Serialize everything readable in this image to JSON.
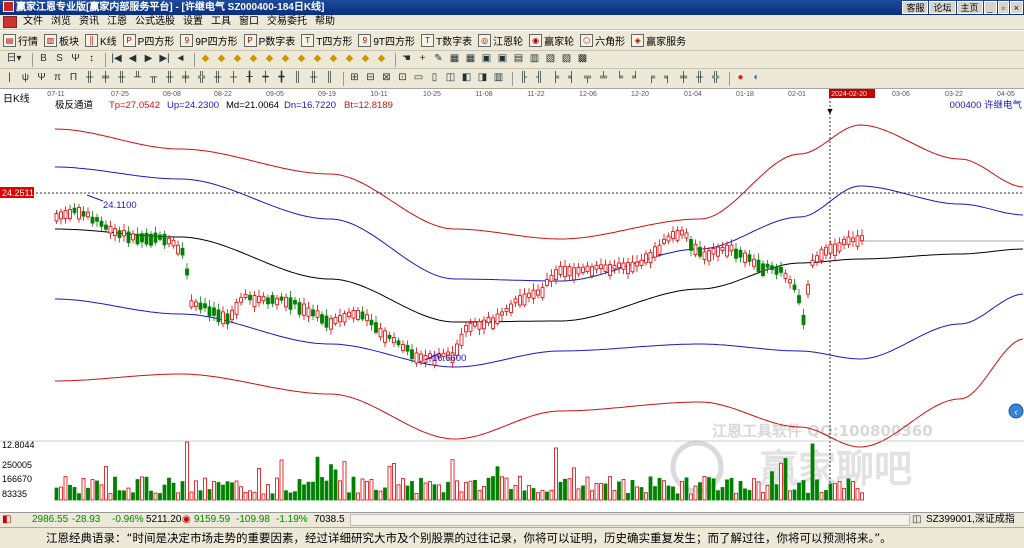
{
  "window": {
    "title": "赢家江恩专业版[赢家内部服务平台] - [许继电气   SZ000400-184日K线]",
    "right_buttons": [
      "客服",
      "论坛",
      "主页"
    ]
  },
  "menu": [
    "文件",
    "浏览",
    "资讯",
    "江恩",
    "公式选股",
    "设置",
    "工具",
    "窗口",
    "交易委托",
    "帮助"
  ],
  "toolbar1": [
    "行情",
    "板块",
    "K线",
    "P四方形",
    "9P四方形",
    "P数字表",
    "T四方形",
    "9T四方形",
    "T数字表",
    "江恩轮",
    "赢家轮",
    "六角形",
    "赢家服务"
  ],
  "toolbar2_icons": [
    "day-select",
    "buy-mark",
    "sell-mark",
    "forecast",
    "arrow-tool"
  ],
  "chart": {
    "period_label": "日K线",
    "indicator": {
      "name": "极反通道",
      "Tp": "Tp=27.0542",
      "Up": "Up=24.2300",
      "Md": "Md=21.0064",
      "Dn": "Dn=16.7220",
      "Bt": "Bt=12.8189"
    },
    "stock_label": "000400 许继电气",
    "price_tag": "24.2511",
    "high_label": "24.1100",
    "low_label": "16.6600",
    "date_ticks": [
      "07-11",
      "07-25",
      "08-08",
      "08-22",
      "09-05",
      "09-19",
      "10-11",
      "10-25",
      "11-08",
      "11-22",
      "12-06",
      "12-20",
      "01-04",
      "01-18",
      "02-01",
      "2024-02-20",
      "03-06",
      "03-22",
      "04-05"
    ],
    "vol_axis": [
      "12.8044",
      "250005",
      "166670",
      "83335"
    ],
    "watermark": [
      "江恩工具软件  QQ:100800360",
      "赢家聊吧"
    ]
  },
  "status": {
    "sh_index": "2986.55",
    "sh_change": "-28.93",
    "sh_pct": "-0.96%",
    "sh_amount": "5211.20",
    "sz_index": "9159.59",
    "sz_change": "-109.98",
    "sz_pct": "-1.19%",
    "sz_amount": "7038.5",
    "right_text": "SZ399001,深证成指"
  },
  "quote": "江恩经典语录：“时间是决定市场走势的重要因素，经过详细研究大市及个别股票的过往记录，你将可以证明，历史确实重复发生；而了解过往，你将可以预测将来。”。",
  "colors": {
    "up": "#e00000",
    "down": "#008000",
    "channel_outer": "#d01010",
    "channel_inner": "#1818c8",
    "mid": "#000000"
  }
}
